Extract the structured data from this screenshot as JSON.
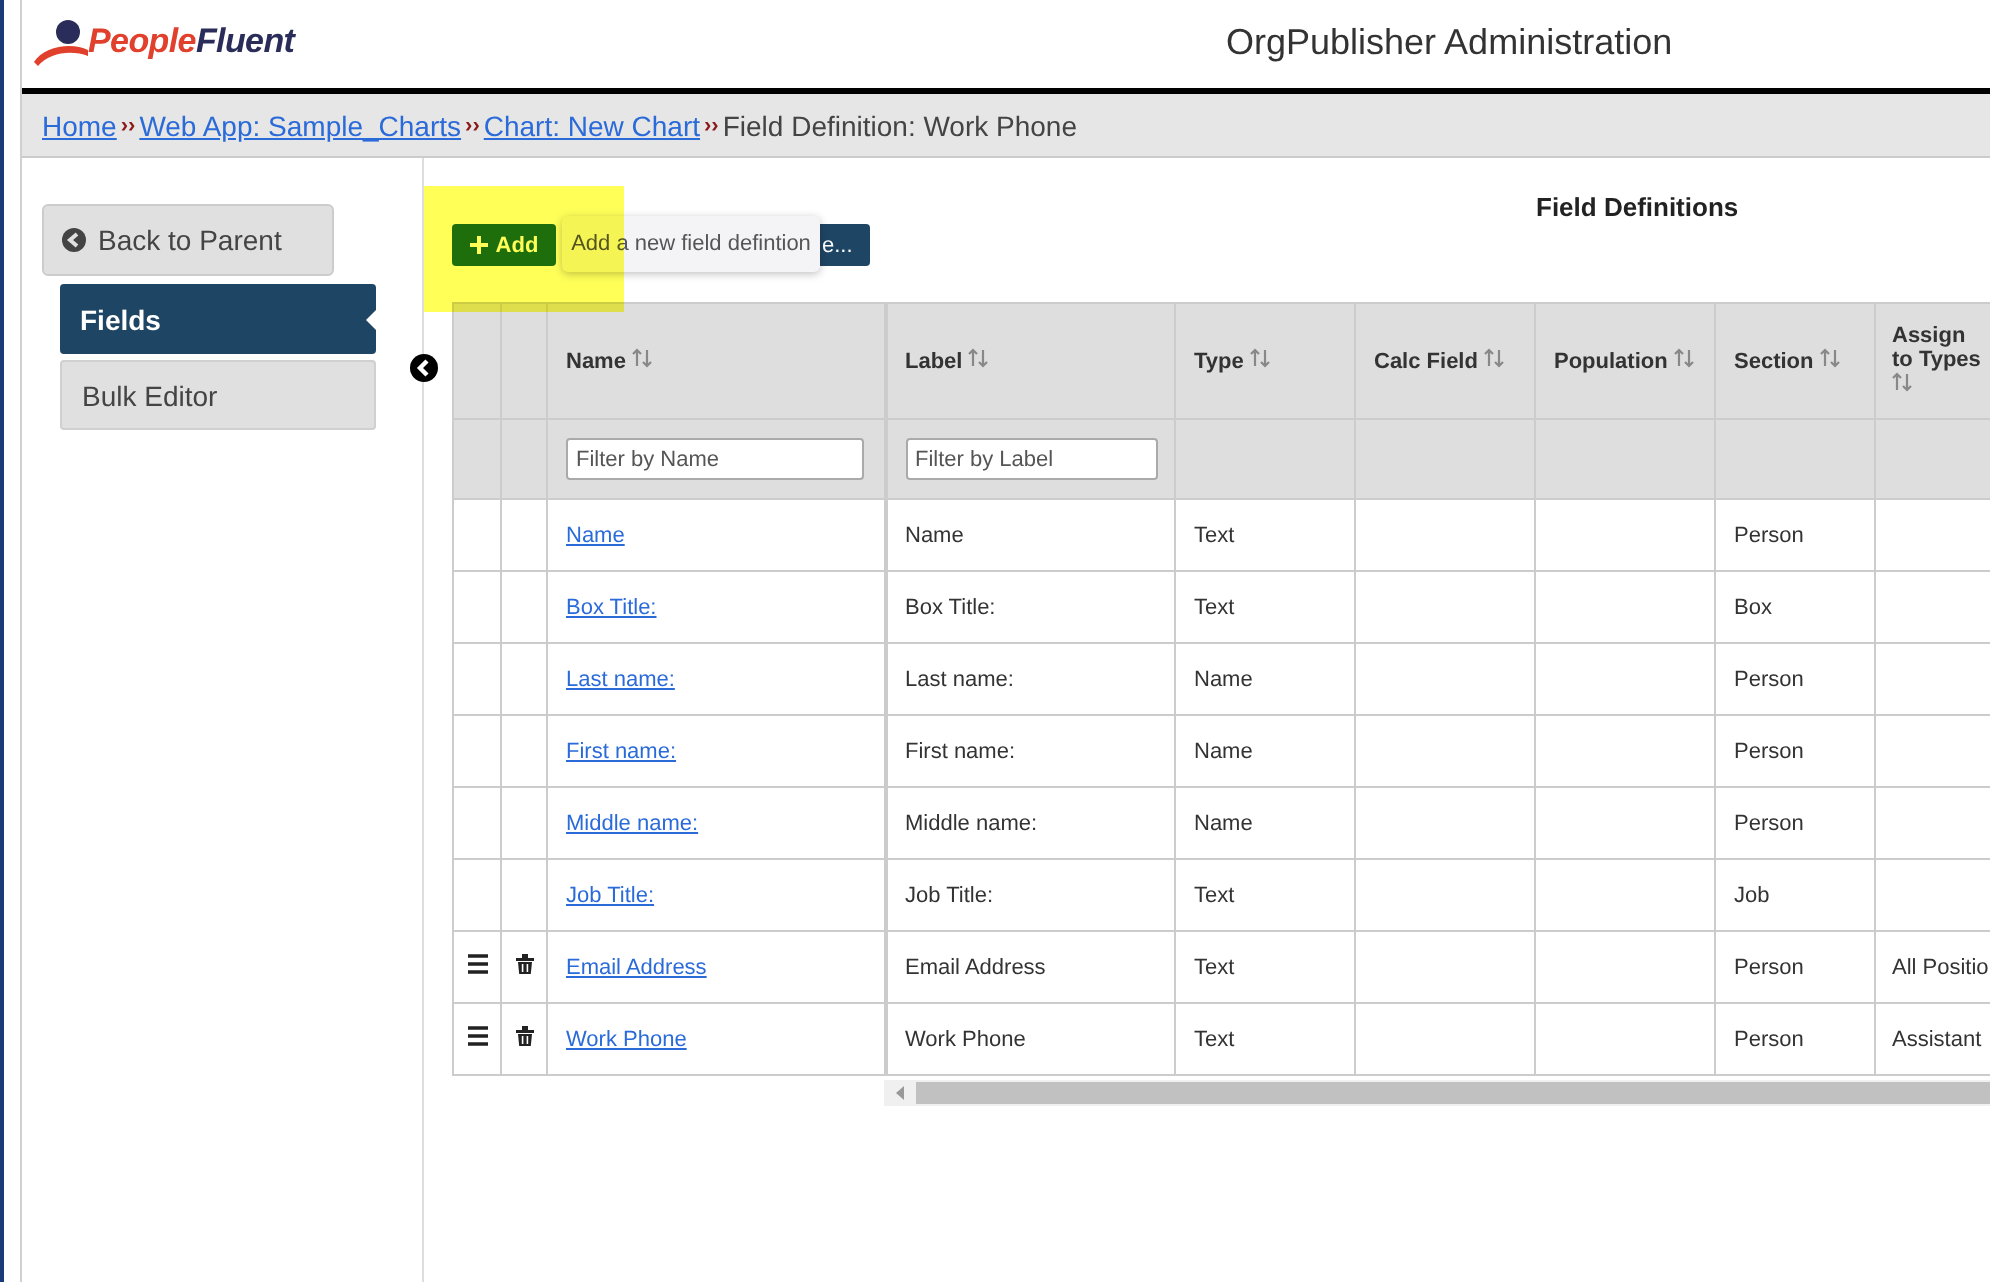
{
  "logo": {
    "words": [
      "People",
      "Fluent"
    ]
  },
  "window": {
    "title": "OrgPublisher Administration"
  },
  "breadcrumbs": [
    {
      "label": "Home",
      "link": true,
      "separator": "››"
    },
    {
      "label": "Web App: Sample_Charts",
      "link": true,
      "separator": "››"
    },
    {
      "label": "Chart: New Chart",
      "link": true,
      "separator": "››"
    },
    {
      "label": "Field Definition: Work Phone",
      "link": false
    }
  ],
  "sidebar": {
    "back_button": "Back to Parent",
    "items": [
      {
        "label": "Fields",
        "selected": true
      },
      {
        "label": "Bulk Editor",
        "selected": false
      }
    ]
  },
  "main": {
    "title": "Field Definitions",
    "add_button": "Add",
    "hidden_button": "e...",
    "tooltip": "Add a new field defintion"
  },
  "table": {
    "columns": [
      {
        "label": "Name",
        "filter_placeholder": "Filter by Name"
      },
      {
        "label": "Label",
        "filter_placeholder": "Filter by Label"
      },
      {
        "label": "Type"
      },
      {
        "label": "Calc Field"
      },
      {
        "label": "Population"
      },
      {
        "label": "Section"
      },
      {
        "label": "Assign to Types"
      }
    ],
    "rows": [
      {
        "movable": false,
        "deletable": false,
        "cells": [
          "Name",
          "Name",
          "Text",
          null,
          null,
          "Person",
          null
        ]
      },
      {
        "movable": false,
        "deletable": false,
        "cells": [
          "Box Title:",
          "Box Title:",
          "Text",
          null,
          null,
          "Box",
          null
        ]
      },
      {
        "movable": false,
        "deletable": false,
        "cells": [
          "Last name:",
          "Last name:",
          "Name",
          null,
          null,
          "Person",
          null
        ]
      },
      {
        "movable": false,
        "deletable": false,
        "cells": [
          "First name:",
          "First name:",
          "Name",
          null,
          null,
          "Person",
          null
        ]
      },
      {
        "movable": false,
        "deletable": false,
        "cells": [
          "Middle name:",
          "Middle name:",
          "Name",
          null,
          null,
          "Person",
          null
        ]
      },
      {
        "movable": false,
        "deletable": false,
        "cells": [
          "Job Title:",
          "Job Title:",
          "Text",
          null,
          null,
          "Job",
          null
        ]
      },
      {
        "movable": true,
        "deletable": true,
        "cells": [
          "Email Address",
          "Email Address",
          "Text",
          null,
          null,
          "Person",
          "All Positio"
        ]
      },
      {
        "movable": true,
        "deletable": true,
        "cells": [
          "Work Phone",
          "Work Phone",
          "Text",
          null,
          null,
          "Person",
          "Assistant"
        ]
      }
    ]
  }
}
